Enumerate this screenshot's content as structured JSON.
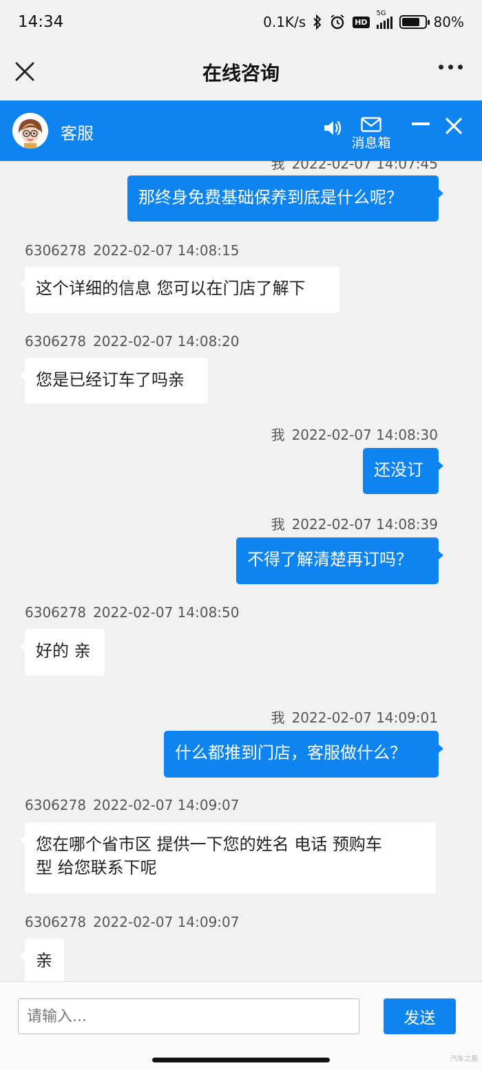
{
  "status": {
    "time": "14:34",
    "speed": "0.1K/s",
    "network": "5G",
    "hd": "HD",
    "battery": "80%",
    "battery_level": 0.8
  },
  "titlebar": {
    "title": "在线咨询"
  },
  "chat_header": {
    "agent_name": "客服",
    "inbox_label": "消息箱"
  },
  "messages": [
    {
      "side": "me",
      "who": "我",
      "time": "2022-02-07 14:07:45",
      "text": "那终身免费基础保养到底是什么呢？"
    },
    {
      "side": "them",
      "who": "6306278",
      "time": "2022-02-07 14:08:15",
      "text": "这个详细的信息 您可以在门店了解下"
    },
    {
      "side": "them",
      "who": "6306278",
      "time": "2022-02-07 14:08:20",
      "text": "您是已经订车了吗亲"
    },
    {
      "side": "me",
      "who": "我",
      "time": "2022-02-07 14:08:30",
      "text": "还没订"
    },
    {
      "side": "me",
      "who": "我",
      "time": "2022-02-07 14:08:39",
      "text": "不得了解清楚再订吗？"
    },
    {
      "side": "them",
      "who": "6306278",
      "time": "2022-02-07 14:08:50",
      "text": "好的 亲"
    },
    {
      "side": "me",
      "who": "我",
      "time": "2022-02-07 14:09:01",
      "text": "什么都推到门店，客服做什么？"
    },
    {
      "side": "them",
      "who": "6306278",
      "time": "2022-02-07 14:09:07",
      "text_line1": "您在哪个省市区 提供一下您的姓名 电话 预购车",
      "text_line2": "型 给您联系下呢"
    },
    {
      "side": "them",
      "who": "6306278",
      "time": "2022-02-07 14:09:07",
      "text": "亲"
    }
  ],
  "input": {
    "placeholder": "请输入...",
    "value": ""
  },
  "send_label": "发送",
  "watermark": "汽车之家",
  "colors": {
    "accent": "#0d84f0",
    "background": "#f1f1f1"
  }
}
